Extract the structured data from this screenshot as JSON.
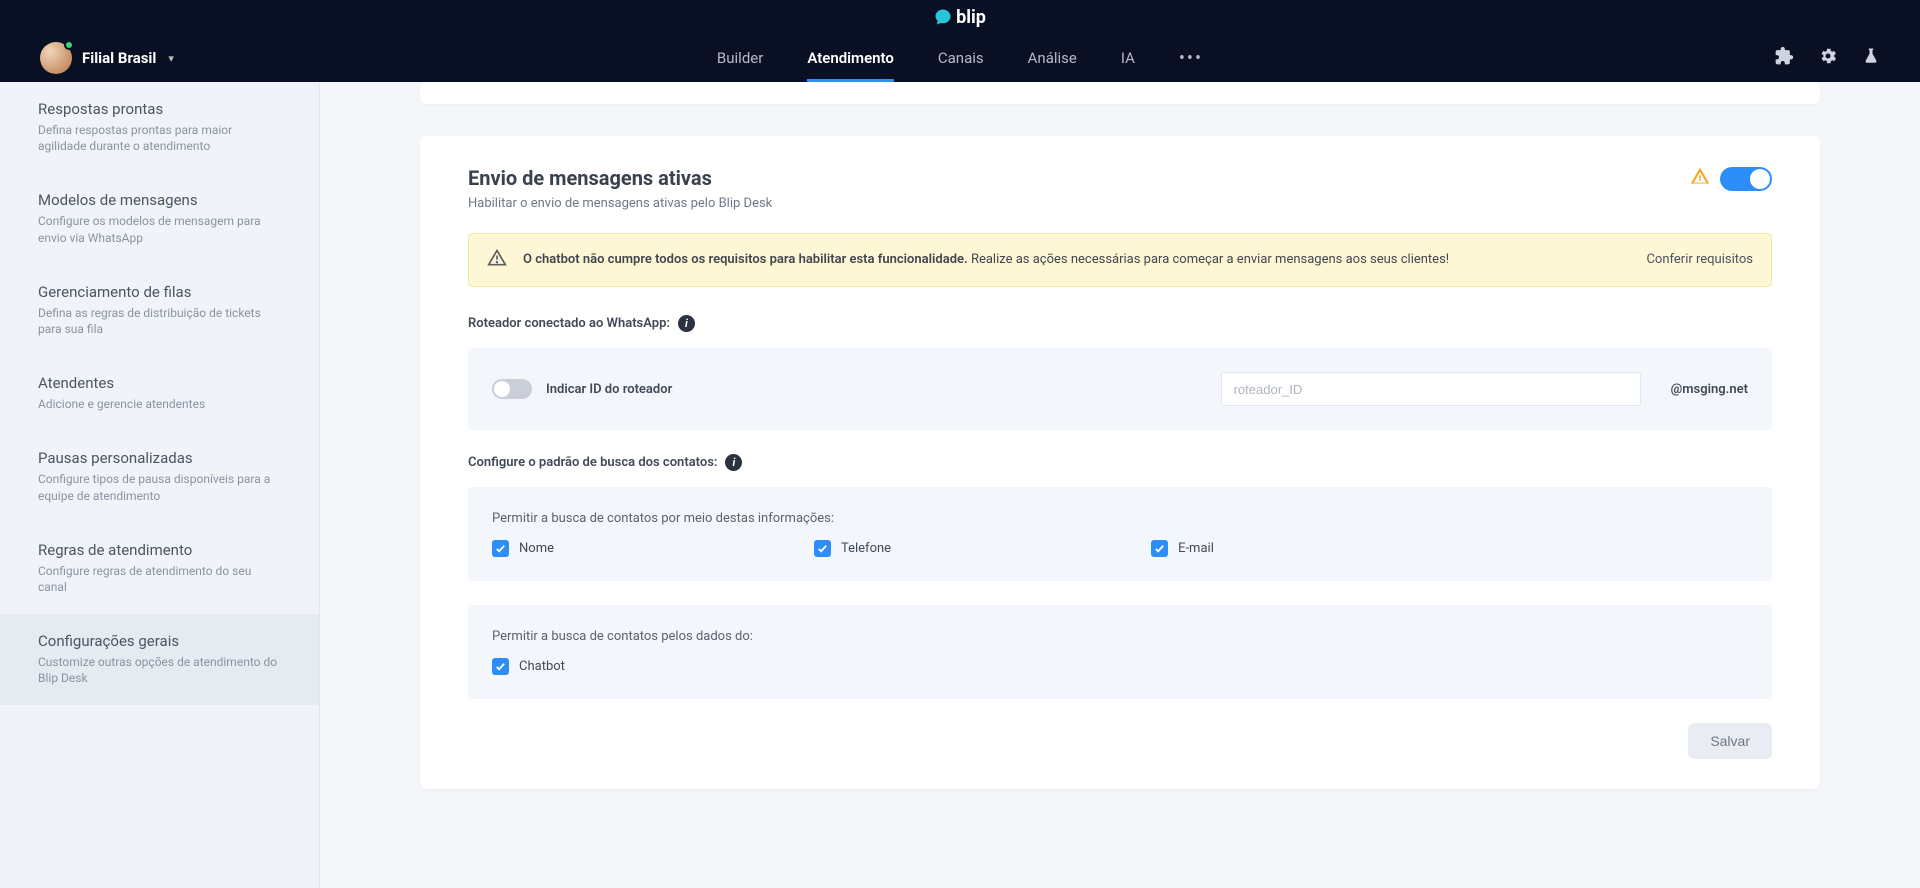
{
  "brand": {
    "name": "blip"
  },
  "org": {
    "name": "Filial Brasil"
  },
  "nav": {
    "items": [
      {
        "label": "Builder"
      },
      {
        "label": "Atendimento"
      },
      {
        "label": "Canais"
      },
      {
        "label": "Análise"
      },
      {
        "label": "IA"
      }
    ],
    "active_index": 1
  },
  "sidebar": {
    "items": [
      {
        "title": "Respostas prontas",
        "desc": "Defina respostas prontas para maior agilidade durante o atendimento"
      },
      {
        "title": "Modelos de mensagens",
        "desc": "Configure os modelos de mensagem para envio via WhatsApp"
      },
      {
        "title": "Gerenciamento de filas",
        "desc": "Defina as regras de distribuição de tickets para sua fila"
      },
      {
        "title": "Atendentes",
        "desc": "Adicione e gerencie atendentes"
      },
      {
        "title": "Pausas personalizadas",
        "desc": "Configure tipos de pausa disponíveis para a equipe de atendimento"
      },
      {
        "title": "Regras de atendimento",
        "desc": "Configure regras de atendimento do seu canal"
      },
      {
        "title": "Configurações gerais",
        "desc": "Customize outras opções de atendimento do Blip Desk"
      }
    ],
    "active_index": 6
  },
  "section": {
    "title": "Envio de mensagens ativas",
    "subtitle": "Habilitar o envio de mensagens ativas pelo Blip Desk",
    "alert": {
      "bold": "O chatbot não cumpre todos os requisitos para habilitar esta funcionalidade.",
      "rest": " Realize as ações necessárias para começar a enviar mensagens aos seus clientes!",
      "action": "Conferir requisitos"
    },
    "router": {
      "label": "Roteador conectado ao WhatsApp:",
      "toggle_label": "Indicar ID do roteador",
      "placeholder": "roteador_ID",
      "domain": "@msging.net"
    },
    "search": {
      "label": "Configure o padrão de busca dos contatos:",
      "info_prompt": "Permitir a busca de contatos por meio destas informações:",
      "options": [
        {
          "label": "Nome"
        },
        {
          "label": "Telefone"
        },
        {
          "label": "E-mail"
        }
      ],
      "data_prompt": "Permitir a busca de contatos pelos dados do:",
      "data_options": [
        {
          "label": "Chatbot"
        }
      ]
    },
    "save_label": "Salvar"
  }
}
